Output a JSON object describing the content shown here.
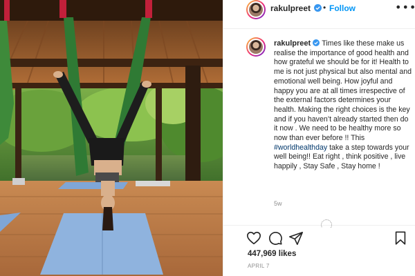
{
  "post": {
    "username": "rakulpreet",
    "follow_label": "Follow",
    "separator": "•",
    "more_label": "•••",
    "caption": {
      "username": "rakulpreet",
      "text_before": "Times like these make us realise the importance of good health and how grateful we should be for it! Health to me is not just physical but also mental and emotional well being. How joyful and happy you are at all times irrespective of the external factors determines your health. Making the right choices is the key and if you haven’t already started then do it now . We need to be healthy more so now than ever before !! This ",
      "hashtag": "#worldhealthday",
      "text_after": " take a step towards your well being!! Eat right , think positive , live happily , Stay Safe , Stay home !"
    },
    "time_ago": "5w",
    "likes": "447,969 likes",
    "date": "APRIL 7"
  },
  "icons": {
    "verified": "verified-badge-icon",
    "like": "heart-icon",
    "comment": "comment-icon",
    "share": "paper-plane-icon",
    "save": "bookmark-icon",
    "more": "more-options-icon",
    "loading": "loading-spinner-icon"
  },
  "colors": {
    "accent": "#0095f6",
    "verified": "#3897f0",
    "text": "#262626",
    "muted": "#8e8e8e",
    "hashtag": "#00376b"
  }
}
